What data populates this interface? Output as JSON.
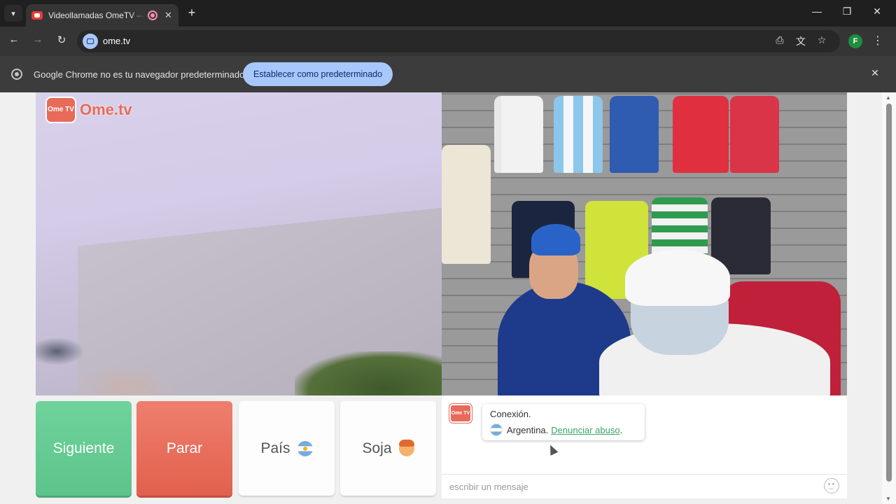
{
  "browser": {
    "tab": {
      "title": "Videollamadas OmeTV — A",
      "recording": true
    },
    "url": "ome.tv",
    "profile_initial": "F",
    "infobar": {
      "message": "Google Chrome no es tu navegador predeterminado",
      "action_label": "Establecer como predeterminado"
    },
    "icons": {
      "tab_search": "chevron-down-icon",
      "new_tab": "plus-icon",
      "back": "arrow-left-icon",
      "forward": "arrow-right-icon",
      "reload": "reload-icon",
      "install": "install-app-icon",
      "translate": "translate-icon",
      "bookmark": "star-icon",
      "menu": "kebab-menu-icon"
    }
  },
  "page": {
    "logo": {
      "badge": "Ome TV",
      "text": "Ome.tv"
    },
    "controls": {
      "next_label": "Siguiente",
      "stop_label": "Parar",
      "country_label": "País",
      "gender_label": "Soja"
    },
    "chat": {
      "avatar": "Ome TV",
      "message_title": "Conexión.",
      "country": "Argentina",
      "separator": " .",
      "report_link": "Denunciar abuso",
      "report_suffix": ".",
      "input_placeholder": "escribir un mensaje"
    }
  },
  "colors": {
    "next": "#5cc48a",
    "stop": "#e2604d",
    "brand": "#e86a5a",
    "link": "#3aa46a",
    "chrome_accent": "#a8c7fa"
  }
}
